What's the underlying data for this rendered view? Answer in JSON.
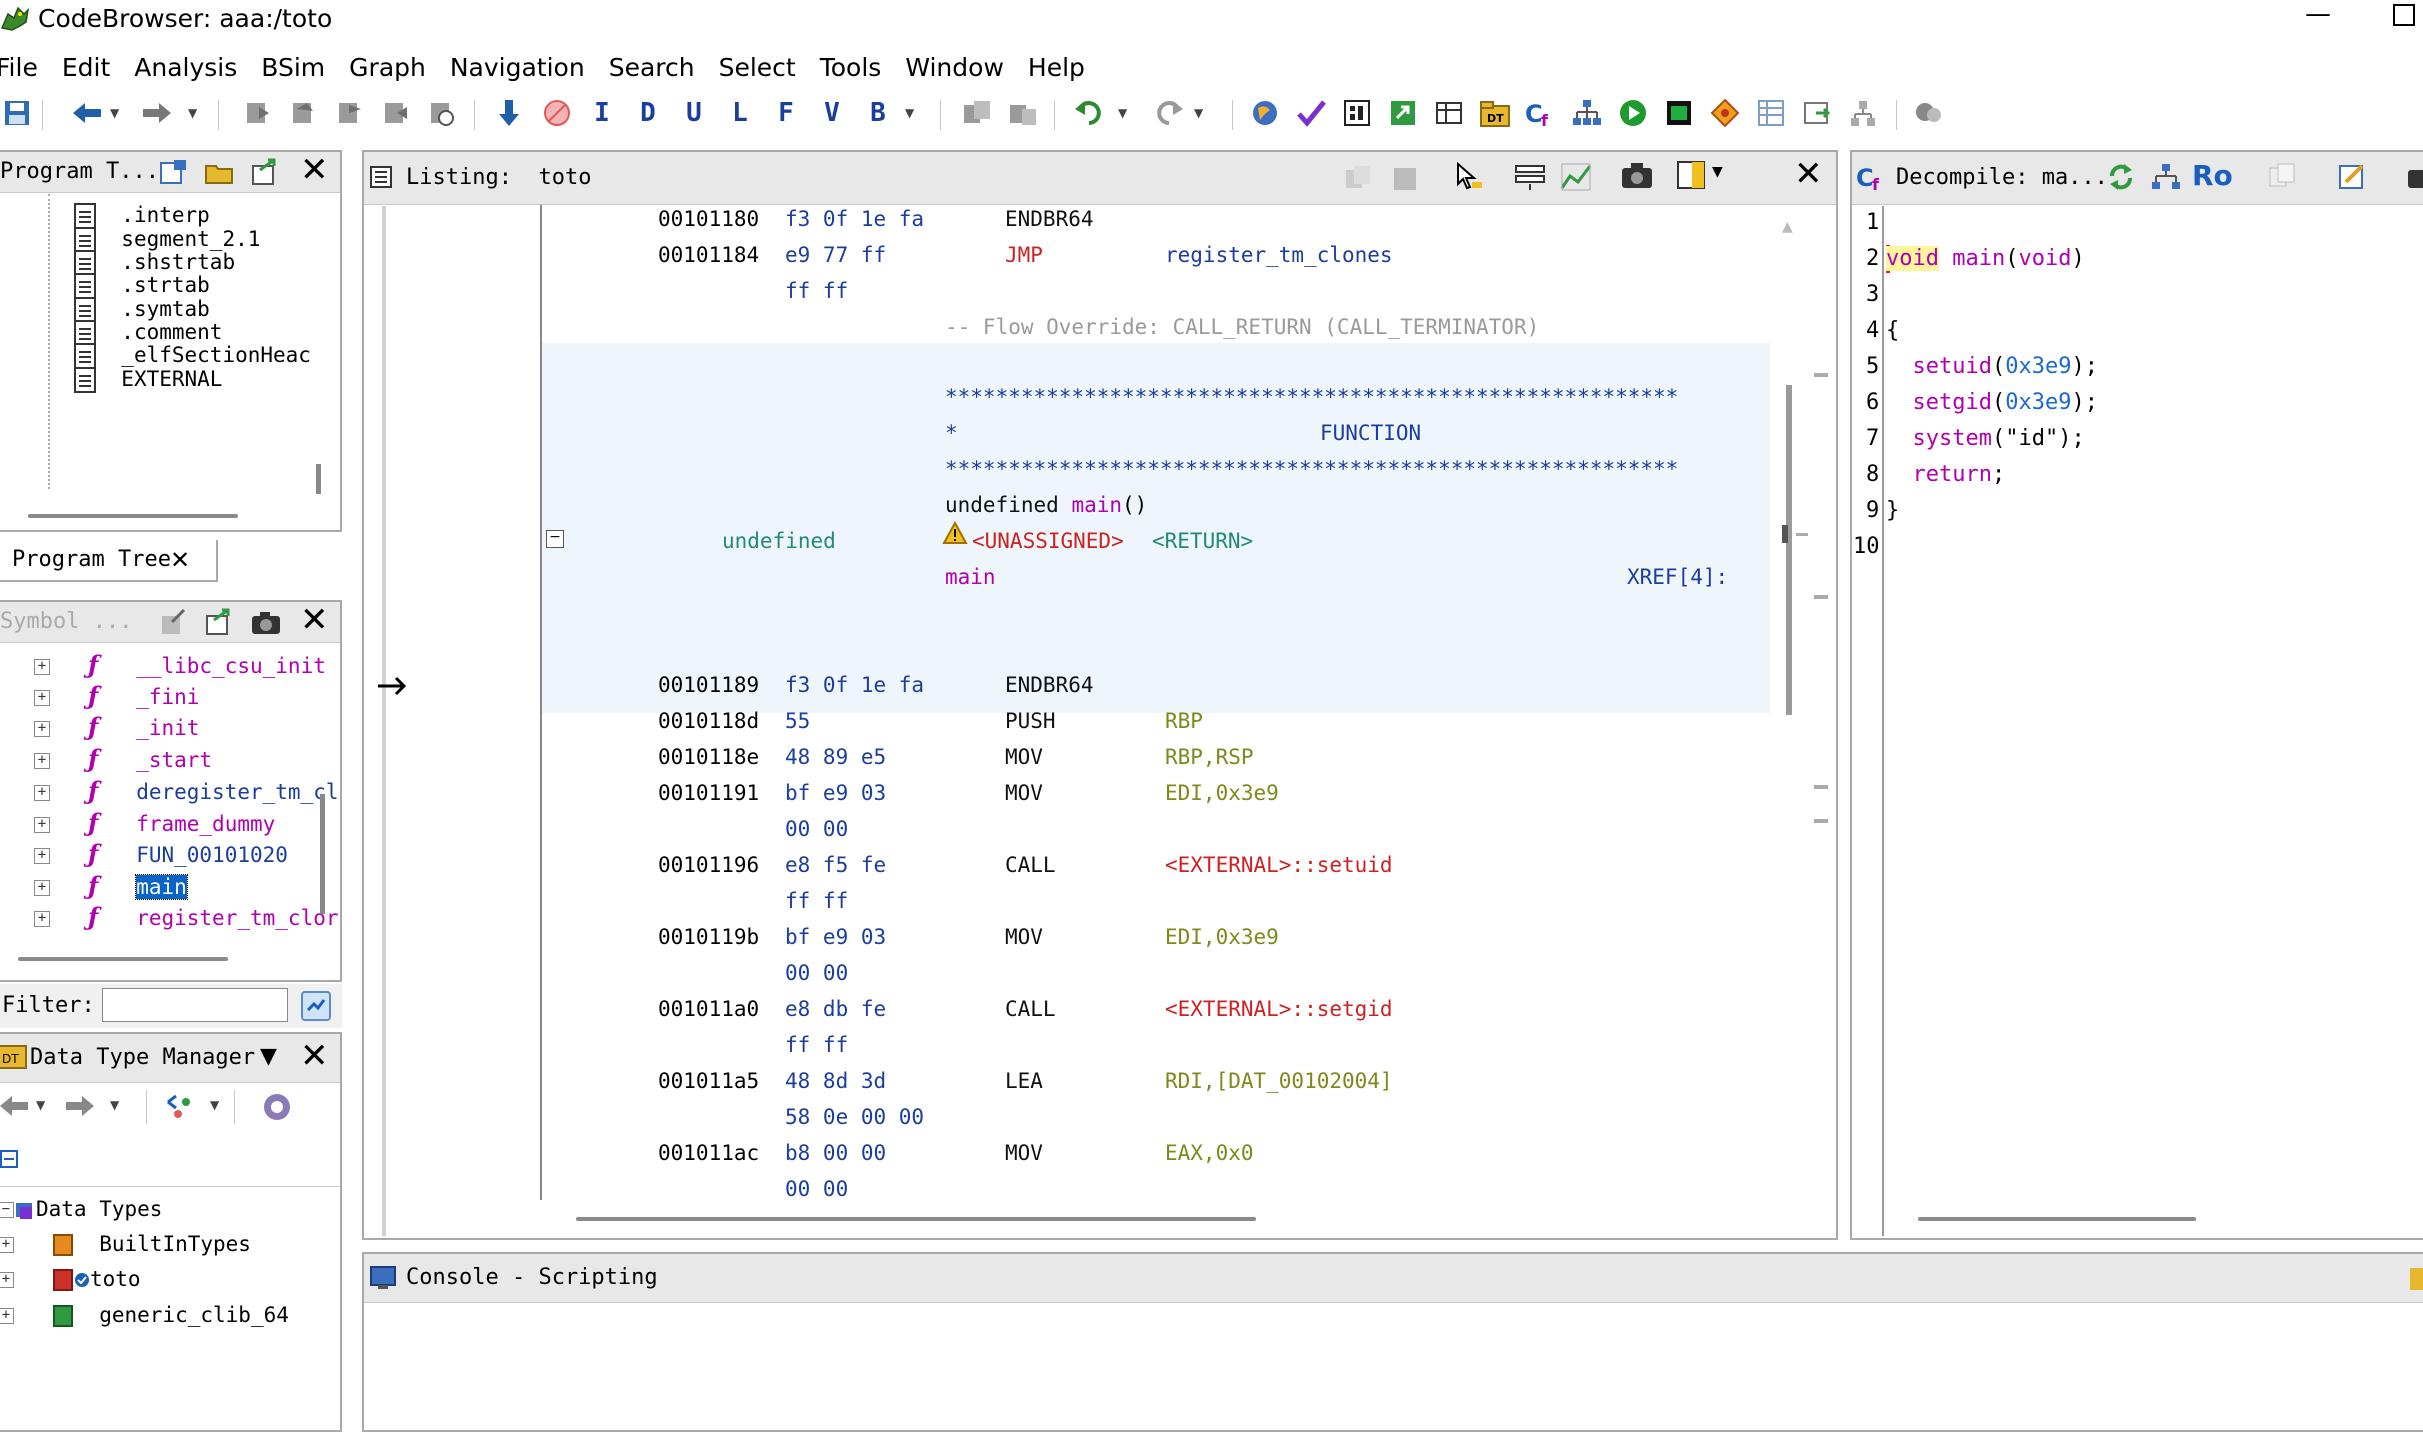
{
  "window": {
    "title": "CodeBrowser: aaa:/toto",
    "minimize": "—"
  },
  "menu": [
    "File",
    "Edit",
    "Analysis",
    "BSim",
    "Graph",
    "Navigation",
    "Search",
    "Select",
    "Tools",
    "Window",
    "Help"
  ],
  "toolbar": {
    "letters": [
      "I",
      "D",
      "U",
      "L",
      "F",
      "V",
      "B"
    ],
    "icons": [
      "save-icon",
      "back-arrow-icon",
      "forward-arrow-icon",
      "nav-icon-1",
      "nav-icon-2",
      "nav-icon-3",
      "nav-icon-4",
      "nav-icon-5",
      "down-arrow-icon",
      "stop-icon",
      "I",
      "D",
      "U",
      "L",
      "F",
      "V",
      "B",
      "cut-icon",
      "paste-icon",
      "undo-icon",
      "redo-icon",
      "globe-icon",
      "check-icon",
      "memory-icon",
      "refresh-green-icon",
      "table-icon",
      "folder-dt-icon",
      "cf-icon",
      "tree-graph-icon",
      "run-icon",
      "terminal-icon",
      "diamond-icon",
      "spreadsheet-icon",
      "export-icon",
      "network-icon",
      "bubble-icon"
    ]
  },
  "program_tree": {
    "header": "Program T...",
    "tab_label": "Program Tree",
    "items": [
      ".interp",
      "segment_2.1",
      ".shstrtab",
      ".strtab",
      ".symtab",
      ".comment",
      "_elfSectionHeac",
      "EXTERNAL"
    ]
  },
  "symbol_tree": {
    "header": "Symbol ...",
    "items": [
      "__libc_csu_init",
      "_fini",
      "_init",
      "_start",
      "deregister_tm_cl",
      "frame_dummy",
      "FUN_00101020",
      "main",
      "register_tm_clor"
    ],
    "selected": "main"
  },
  "filter": {
    "label": "Filter:",
    "value": ""
  },
  "data_type_manager": {
    "header": "Data Type Manager",
    "root": "Data Types",
    "items": [
      "BuiltInTypes",
      "toto",
      "generic_clib_64"
    ]
  },
  "listing": {
    "header": "Listing:",
    "program": "toto",
    "flow_override": "-- Flow Override: CALL_RETURN (CALL_TERMINATOR)",
    "stars": "**********************************************************",
    "function_label": "FUNCTION",
    "star_prefix": "*",
    "signature_ret": "undefined",
    "signature_name": "main",
    "signature_args": "()",
    "ret_type": "undefined",
    "unassigned": "<UNASSIGNED>",
    "return_tag": "<RETURN>",
    "func_label": "main",
    "xref": "XREF[4]:",
    "rows": [
      {
        "addr": "00101180",
        "bytes": "f3 0f 1e fa",
        "mnem": "ENDBR64",
        "op": ""
      },
      {
        "addr": "00101184",
        "bytes": "e9 77 ff",
        "mnem": "JMP",
        "op": "register_tm_clones"
      },
      {
        "addr": "",
        "bytes": "ff ff",
        "mnem": "",
        "op": ""
      },
      {
        "addr": "00101189",
        "bytes": "f3 0f 1e fa",
        "mnem": "ENDBR64",
        "op": ""
      },
      {
        "addr": "0010118d",
        "bytes": "55",
        "mnem": "PUSH",
        "op": "RBP"
      },
      {
        "addr": "0010118e",
        "bytes": "48 89 e5",
        "mnem": "MOV",
        "op": "RBP,RSP"
      },
      {
        "addr": "00101191",
        "bytes": "bf e9 03",
        "mnem": "MOV",
        "op": "EDI,0x3e9"
      },
      {
        "addr": "",
        "bytes": "00 00",
        "mnem": "",
        "op": ""
      },
      {
        "addr": "00101196",
        "bytes": "e8 f5 fe",
        "mnem": "CALL",
        "op": "<EXTERNAL>::setuid"
      },
      {
        "addr": "",
        "bytes": "ff ff",
        "mnem": "",
        "op": ""
      },
      {
        "addr": "0010119b",
        "bytes": "bf e9 03",
        "mnem": "MOV",
        "op": "EDI,0x3e9"
      },
      {
        "addr": "",
        "bytes": "00 00",
        "mnem": "",
        "op": ""
      },
      {
        "addr": "001011a0",
        "bytes": "e8 db fe",
        "mnem": "CALL",
        "op": "<EXTERNAL>::setgid"
      },
      {
        "addr": "",
        "bytes": "ff ff",
        "mnem": "",
        "op": ""
      },
      {
        "addr": "001011a5",
        "bytes": "48 8d 3d",
        "mnem": "LEA",
        "op": "RDI,[DAT_00102004]"
      },
      {
        "addr": "",
        "bytes": "58 0e 00 00",
        "mnem": "",
        "op": ""
      },
      {
        "addr": "001011ac",
        "bytes": "b8 00 00",
        "mnem": "MOV",
        "op": "EAX,0x0"
      },
      {
        "addr": "",
        "bytes": "00 00",
        "mnem": "",
        "op": ""
      }
    ]
  },
  "decompile": {
    "header": "Decompile: ma...",
    "ro": "Ro",
    "lines": [
      {
        "n": "1",
        "code": ""
      },
      {
        "n": "2",
        "code": "void main(void)"
      },
      {
        "n": "3",
        "code": ""
      },
      {
        "n": "4",
        "code": "{"
      },
      {
        "n": "5",
        "code": "  setuid(0x3e9);"
      },
      {
        "n": "6",
        "code": "  setgid(0x3e9);"
      },
      {
        "n": "7",
        "code": "  system(\"id\");"
      },
      {
        "n": "8",
        "code": "  return;"
      },
      {
        "n": "9",
        "code": "}"
      },
      {
        "n": "10",
        "code": ""
      }
    ]
  },
  "console": {
    "header": "Console - Scripting"
  },
  "colors": {
    "selection": "#0a64c8",
    "highlight_bg": "#eef6fc",
    "header_bg": "#e8e8e8"
  }
}
